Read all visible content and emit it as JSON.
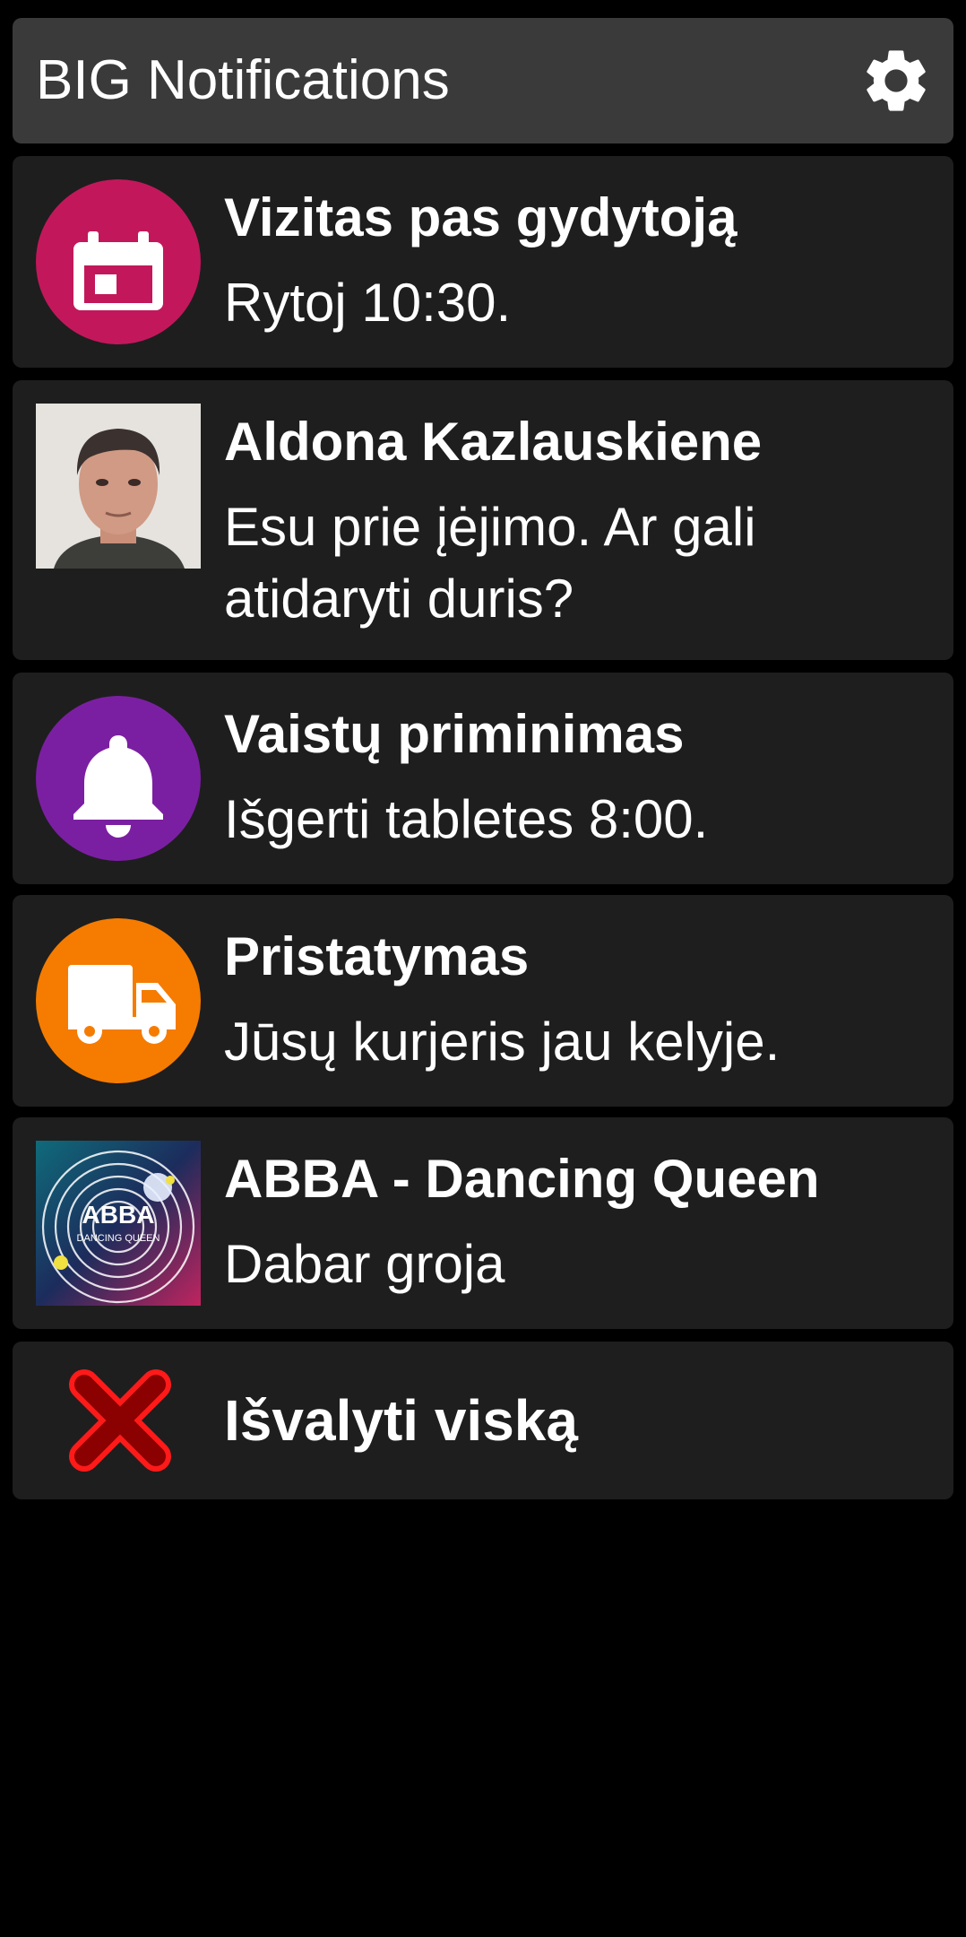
{
  "app": {
    "title": "BIG Notifications",
    "settings_icon": "gear-icon"
  },
  "notifications": [
    {
      "icon": "calendar-icon",
      "icon_bg": "#c2185b",
      "title": "Vizitas pas gydytoją",
      "body": "Rytoj 10:30."
    },
    {
      "icon": "person-photo",
      "title": "Aldona Kazlauskiene",
      "body": "Esu prie įėjimo. Ar gali atidaryti duris?"
    },
    {
      "icon": "bell-icon",
      "icon_bg": "#7b1fa2",
      "title": "Vaistų priminimas",
      "body": "Išgerti tabletes 8:00."
    },
    {
      "icon": "truck-icon",
      "icon_bg": "#f57c00",
      "title": "Pristatymas",
      "body": "Jūsų kurjeris jau kelyje."
    },
    {
      "icon": "album-art",
      "album_text": "ABBA",
      "album_subtext": "DANCING QUEEN",
      "title": "ABBA - Dancing Queen",
      "body": "Dabar groja"
    }
  ],
  "clear_all": {
    "icon": "close-icon",
    "icon_color": "#d50000",
    "label": "Išvalyti viską"
  }
}
